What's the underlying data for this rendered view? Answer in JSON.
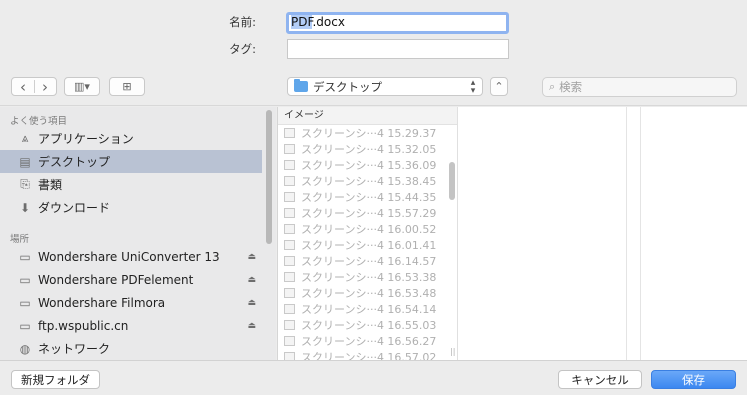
{
  "save": {
    "name_label": "名前:",
    "name_selected": "PDF",
    "name_rest": ".docx",
    "tags_label": "タグ:",
    "tags_value": ""
  },
  "toolbar": {
    "back_icon": "‹",
    "forward_icon": "›",
    "view_icon": "▥▾",
    "new_folder_icon": "⊞",
    "location": "デスクトップ",
    "location_arrows": "⌃⌄",
    "expand_icon": "⌃",
    "search_placeholder": "検索"
  },
  "sidebar": {
    "favorites_header": "よく使う項目",
    "favorites": [
      {
        "label": "アプリケーション",
        "icon": "applications-icon"
      },
      {
        "label": "デスクトップ",
        "icon": "desktop-icon",
        "selected": true
      },
      {
        "label": "書類",
        "icon": "documents-icon"
      },
      {
        "label": "ダウンロード",
        "icon": "downloads-icon"
      }
    ],
    "places_header": "場所",
    "places": [
      {
        "label": "Wondershare UniConverter 13",
        "eject": true
      },
      {
        "label": "Wondershare PDFelement",
        "eject": true
      },
      {
        "label": "Wondershare Filmora",
        "eject": true
      },
      {
        "label": "ftp.wspublic.cn",
        "eject": true
      },
      {
        "label": "ネットワーク",
        "eject": false
      }
    ]
  },
  "browser": {
    "column_header": "イメージ",
    "files": [
      "スクリーンシ···4 15.29.37",
      "スクリーンシ···4 15.32.05",
      "スクリーンシ···4 15.36.09",
      "スクリーンシ···4 15.38.45",
      "スクリーンシ···4 15.44.35",
      "スクリーンシ···4 15.57.29",
      "スクリーンシ···4 16.00.52",
      "スクリーンシ···4 16.01.41",
      "スクリーンシ···4 16.14.57",
      "スクリーンシ···4 16.53.38",
      "スクリーンシ···4 16.53.48",
      "スクリーンシ···4 16.54.14",
      "スクリーンシ···4 16.55.03",
      "スクリーンシ···4 16.56.27",
      "スクリーンシ···4 16.57.02"
    ]
  },
  "footer": {
    "new_folder": "新規フォルダ",
    "cancel": "キャンセル",
    "save": "保存"
  },
  "colors": {
    "accent": "#3c87f0",
    "selection": "#b9c2d3",
    "folder": "#5fa6ea"
  }
}
